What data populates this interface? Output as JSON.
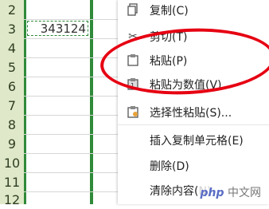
{
  "sheet": {
    "rows": [
      "2",
      "3",
      "4",
      "5",
      "6",
      "7",
      "8",
      "9",
      "10",
      "11",
      "12"
    ],
    "selected_cell_value": "343124"
  },
  "menu": {
    "items": [
      {
        "label": "复制(C)",
        "icon": "copy-icon"
      },
      {
        "label": "剪切(T)",
        "icon": "scissors-icon"
      },
      {
        "label": "粘贴(P)",
        "icon": "paste-icon"
      },
      {
        "label": "粘贴为数值(V)",
        "icon": "paste-values-icon"
      },
      {
        "label": "选择性粘贴(S)...",
        "icon": "paste-special-icon"
      },
      {
        "label": "插入复制单元格(E)",
        "icon": ""
      },
      {
        "label": "删除(D)",
        "icon": ""
      },
      {
        "label": "清除内容(N)",
        "icon": ""
      }
    ]
  },
  "watermark": {
    "brand": "php",
    "text": "中文网"
  },
  "colors": {
    "highlight_ring": "#e60012",
    "selection_green": "#2f8a39",
    "row_header_bg": "#dfe9c9"
  }
}
